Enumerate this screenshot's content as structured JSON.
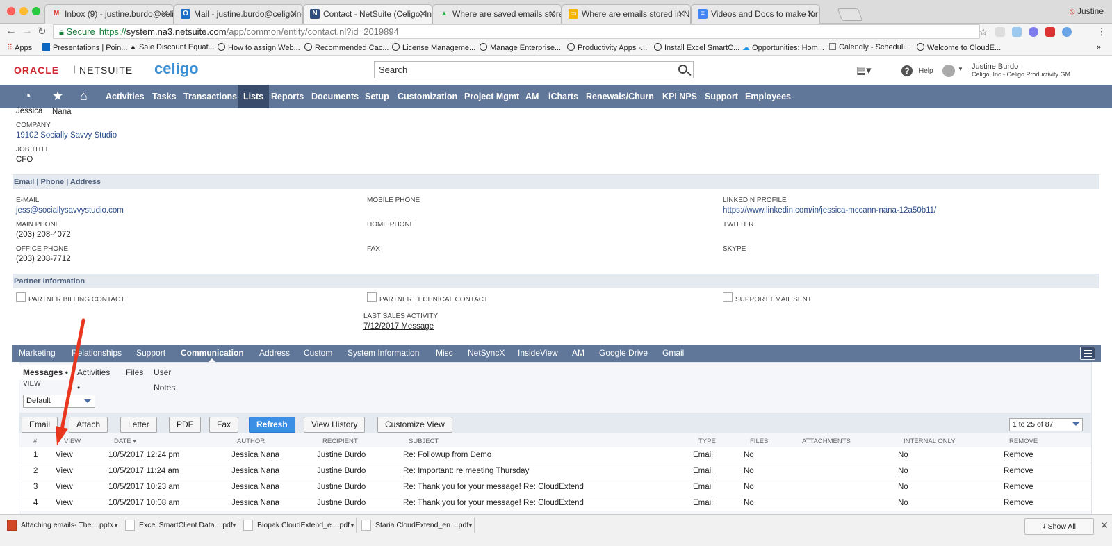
{
  "browser": {
    "tabs": [
      {
        "title": "Inbox (9) - justine.burdo@celig",
        "icon": "gmail-icon",
        "color": "#d93025",
        "glyph": "M"
      },
      {
        "title": "Mail - justine.burdo@celigoinc.",
        "icon": "outlook-icon",
        "color": "#1a6fc7",
        "glyph": "O"
      },
      {
        "title": "Contact - NetSuite (Celigo, Inc",
        "icon": "netsuite-icon",
        "color": "#2c4f7c",
        "glyph": "N"
      },
      {
        "title": "Where are saved emails stored",
        "icon": "drive-icon",
        "color": "#34a853",
        "glyph": "▲"
      },
      {
        "title": "Where are emails stored in Net",
        "icon": "slides-icon",
        "color": "#f4b400",
        "glyph": "▭"
      },
      {
        "title": "Videos and Docs to make for C",
        "icon": "docs-icon",
        "color": "#4285f4",
        "glyph": "≡"
      }
    ],
    "profile": "Justine",
    "url_secure": "Secure",
    "url_scheme": "https://",
    "url_host": "system.na3.netsuite.com",
    "url_path": "/app/common/entity/contact.nl?id=2019894"
  },
  "bookmarks": [
    "Apps",
    "Presentations | Poin...",
    "Sale Discount Equat...",
    "How to assign Web...",
    "Recommended Cac...",
    "License Manageme...",
    "Manage Enterprise...",
    "Productivity Apps -...",
    "Install Excel SmartC...",
    "Opportunities: Hom...",
    "Calendly - Scheduli...",
    "Welcome to CloudE..."
  ],
  "header": {
    "oracle": "ORACLE",
    "netsuite": "NETSUITE",
    "brand": "celigo",
    "search_placeholder": "Search",
    "help": "Help",
    "user_name": "Justine Burdo",
    "user_company": "Celigo, Inc - Celigo Productivity GM"
  },
  "nav": {
    "items": [
      "Activities",
      "Tasks",
      "Transactions",
      "Lists",
      "Reports",
      "Documents",
      "Setup",
      "Customization",
      "Project Mgmt",
      "AM",
      "iCharts",
      "Renewals/Churn",
      "KPI NPS",
      "Support",
      "Employees"
    ],
    "selected": "Lists"
  },
  "contact": {
    "first_name": "Jessica",
    "last_name": "Nana",
    "company_label": "COMPANY",
    "company": "19102 Socially Savvy Studio",
    "job_title_label": "JOB TITLE",
    "job_title": "CFO"
  },
  "email_section": {
    "title": "Email | Phone | Address",
    "email_label": "E-MAIL",
    "email": "jess@sociallysavvystudio.com",
    "main_phone_label": "MAIN PHONE",
    "main_phone": "(203) 208-4072",
    "office_phone_label": "OFFICE PHONE",
    "office_phone": "(203) 208-7712",
    "mobile_label": "MOBILE PHONE",
    "home_label": "HOME PHONE",
    "fax_label": "FAX",
    "linkedin_label": "LINKEDIN PROFILE",
    "linkedin": "https://www.linkedin.com/in/jessica-mccann-nana-12a50b11/",
    "twitter_label": "TWITTER",
    "skype_label": "SKYPE"
  },
  "partner_section": {
    "title": "Partner Information",
    "billing": "PARTNER BILLING CONTACT",
    "technical": "PARTNER TECHNICAL CONTACT",
    "support_email": "SUPPORT EMAIL SENT",
    "last_sales_label": "LAST SALES ACTIVITY",
    "last_sales": "7/12/2017 Message"
  },
  "subtabs": {
    "items": [
      "Marketing",
      "Relationships",
      "Support",
      "Communication",
      "Address",
      "Custom",
      "System Information",
      "Misc",
      "NetSyncX",
      "InsideView",
      "AM",
      "Google Drive",
      "Gmail"
    ],
    "selected": "Communication"
  },
  "comm": {
    "pills": [
      "Messages •",
      "Activities •",
      "Files",
      "User Notes"
    ],
    "view_label": "VIEW",
    "view_value": "Default",
    "buttons": [
      "Email",
      "Attach",
      "Letter",
      "PDF",
      "Fax",
      "Refresh",
      "View History",
      "Customize View"
    ],
    "pager": "1 to 25 of 87",
    "columns": [
      "#",
      "VIEW",
      "DATE ▾",
      "AUTHOR",
      "RECIPIENT",
      "SUBJECT",
      "TYPE",
      "FILES",
      "ATTACHMENTS",
      "INTERNAL ONLY",
      "REMOVE"
    ],
    "rows": [
      {
        "n": "1",
        "view": "View",
        "date": "10/5/2017 12:24 pm",
        "author": "Jessica Nana",
        "recipient": "Justine Burdo",
        "subject": "Re: Followup from Demo",
        "type": "Email",
        "files": "No",
        "internal": "No",
        "remove": "Remove"
      },
      {
        "n": "2",
        "view": "View",
        "date": "10/5/2017 11:24 am",
        "author": "Jessica Nana",
        "recipient": "Justine Burdo",
        "subject": "Re: Important: re meeting Thursday",
        "type": "Email",
        "files": "No",
        "internal": "No",
        "remove": "Remove"
      },
      {
        "n": "3",
        "view": "View",
        "date": "10/5/2017 10:23 am",
        "author": "Jessica Nana",
        "recipient": "Justine Burdo",
        "subject": "Re: Thank you for your message! Re: CloudExtend",
        "type": "Email",
        "files": "No",
        "internal": "No",
        "remove": "Remove"
      },
      {
        "n": "4",
        "view": "View",
        "date": "10/5/2017 10:08 am",
        "author": "Jessica Nana",
        "recipient": "Justine Burdo",
        "subject": "Re: Thank you for your message! Re: CloudExtend",
        "type": "Email",
        "files": "No",
        "internal": "No",
        "remove": "Remove"
      }
    ]
  },
  "downloads": {
    "items": [
      "Attaching emails- The....pptx",
      "Excel SmartClient Data....pdf",
      "Biopak CloudExtend_e....pdf",
      "Staria CloudExtend_en....pdf"
    ],
    "show_all": "Show All"
  },
  "colors": {
    "nav": "#607799",
    "nav_selected": "#3a4c6b",
    "link": "#2a4d8e",
    "annotation_arrow": "#e8361f",
    "refresh": "#3b8fe5"
  }
}
